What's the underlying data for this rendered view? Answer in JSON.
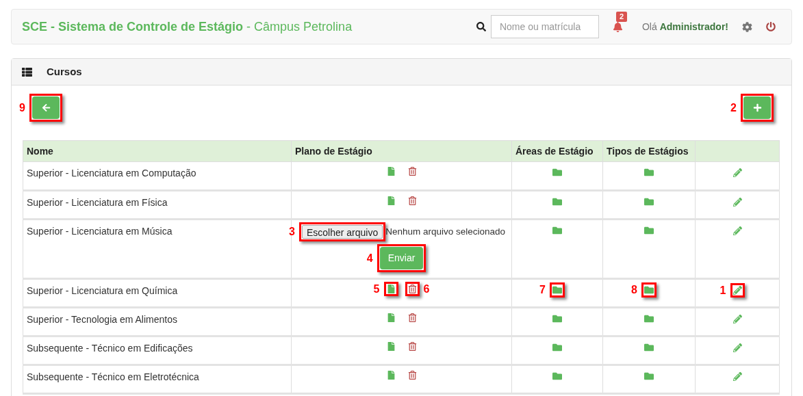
{
  "navbar": {
    "brand": "SCE - Sistema de Controle de Estágio",
    "subtitle": "- Câmpus Petrolina",
    "search": {
      "placeholder": "Nome ou matrícula"
    },
    "notifications": {
      "count": "2"
    },
    "greeting": "Olá **Administrador!**"
  },
  "panel": {
    "title": "Cursos",
    "back_button": {
      "callout": "9"
    },
    "add_button": {
      "callout": "2"
    }
  },
  "table": {
    "columns": [
      "Nome",
      "Plano de Estágio",
      "Áreas de Estágio",
      "Tipos de Estágios"
    ],
    "rows": [
      {
        "kind": "plan",
        "name": "Superior - Licenciatura em Computação"
      },
      {
        "kind": "plan",
        "name": "Superior - Licenciatura em Física"
      },
      {
        "kind": "upload",
        "name": "Superior - Licenciatura em Música",
        "file_button": "Escolher arquivo",
        "file_status": "Nenhum arquivo selecionado",
        "submit": "Enviar",
        "callouts": {
          "file_button": "3",
          "submit": "4"
        }
      },
      {
        "kind": "plan",
        "name": "Superior - Licenciatura em Química",
        "callouts": {
          "plan": "5",
          "delete": "6",
          "areas": "7",
          "types": "8",
          "edit": "1"
        }
      },
      {
        "kind": "plan",
        "name": "Superior - Tecnologia em Alimentos"
      },
      {
        "kind": "plan",
        "name": "Subsequente - Técnico em Edificações"
      },
      {
        "kind": "plan",
        "name": "Subsequente - Técnico em Eletrotécnica"
      }
    ]
  }
}
